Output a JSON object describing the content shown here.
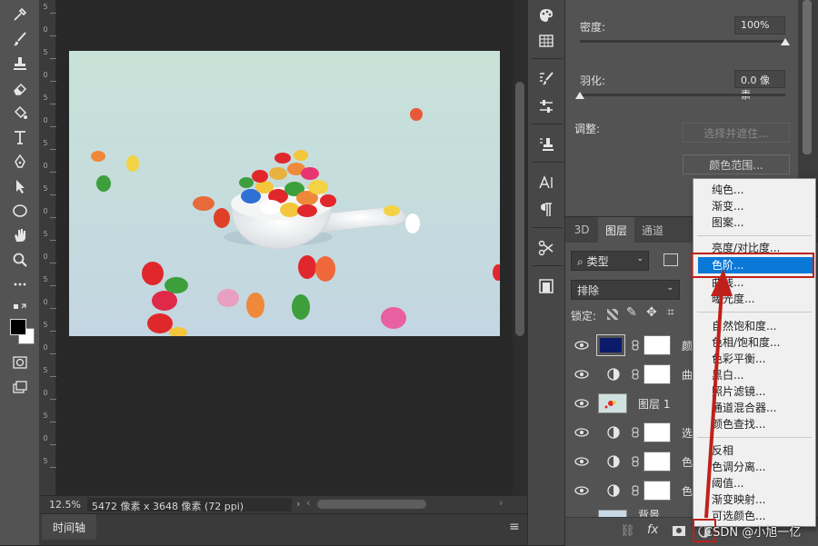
{
  "status": {
    "zoom": "12.5%",
    "doc_info": "5472 像素 x 3648 像素 (72 ppi)"
  },
  "timeline": {
    "tab_label": "时间轴"
  },
  "ruler": {
    "labels": [
      "5",
      "0",
      "5",
      "0",
      "5",
      "0",
      "5",
      "0",
      "5",
      "0",
      "5",
      "0",
      "5",
      "0",
      "5",
      "0",
      "5",
      "0",
      "5",
      "0",
      "5"
    ]
  },
  "properties": {
    "density_label": "密度:",
    "density_value": "100%",
    "density_fraction": 1.0,
    "feather_label": "羽化:",
    "feather_value": "0.0 像素",
    "feather_fraction": 0.0,
    "adjust_label": "调整:",
    "select_mask_button": "选择并遮住...",
    "color_range_button": "颜色范围..."
  },
  "layers_panel": {
    "tabs": [
      "3D",
      "图层",
      "通道"
    ],
    "active_tab": "图层",
    "filter_kind": "类型",
    "blend_mode": "排除",
    "lock_label": "锁定:",
    "layers": [
      {
        "name": "颜",
        "type": "fill"
      },
      {
        "name": "曲",
        "type": "adjust"
      },
      {
        "name": "图层 1",
        "type": "image"
      },
      {
        "name": "选",
        "type": "adjust"
      },
      {
        "name": "色",
        "type": "adjust"
      },
      {
        "name": "色",
        "type": "adjust"
      },
      {
        "name": "背景",
        "type": "image"
      }
    ],
    "footer_icons": [
      "link-icon",
      "fx-icon",
      "mask-icon",
      "adjustment-icon"
    ],
    "fx_label": "fx"
  },
  "adjustment_menu": {
    "groups": [
      [
        "纯色...",
        "渐变...",
        "图案..."
      ],
      [
        "亮度/对比度...",
        "色阶...",
        "曲线...",
        "曝光度..."
      ],
      [
        "自然饱和度...",
        "色相/饱和度...",
        "色彩平衡...",
        "黑白...",
        "照片滤镜...",
        "通道混合器...",
        "颜色查找..."
      ],
      [
        "反相",
        "色调分离...",
        "阈值...",
        "渐变映射...",
        "可选颜色..."
      ]
    ],
    "highlighted": "色阶..."
  },
  "watermark": "CSDN @小旭一亿",
  "colors": {
    "highlight": "#0a78d7",
    "annotation_red": "#c0201a",
    "fill_layer_swatch": "#0b1a6b"
  }
}
